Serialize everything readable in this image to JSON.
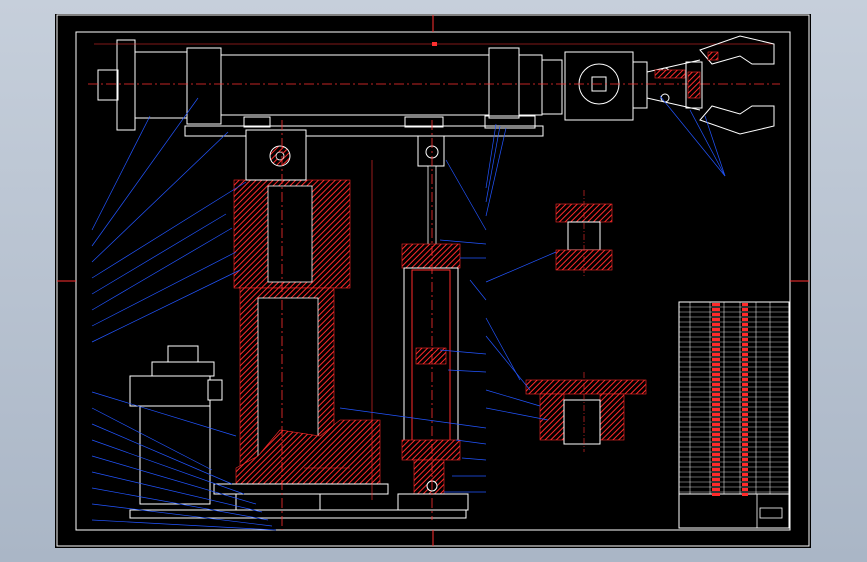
{
  "drawing": {
    "title_block_label": "",
    "notes_title": "",
    "notes_lines": [
      "",
      ""
    ]
  },
  "colors": {
    "background": "#000000",
    "outline": "#ffffff",
    "section_hatch": "#ff2a2a",
    "centerline": "#ff3030",
    "leader": "#2255ff",
    "notes": "#00ff00",
    "workspace": "#b9c3d1"
  },
  "icons": [
    "view-cube",
    "mechanical-assembly-drawing"
  ]
}
